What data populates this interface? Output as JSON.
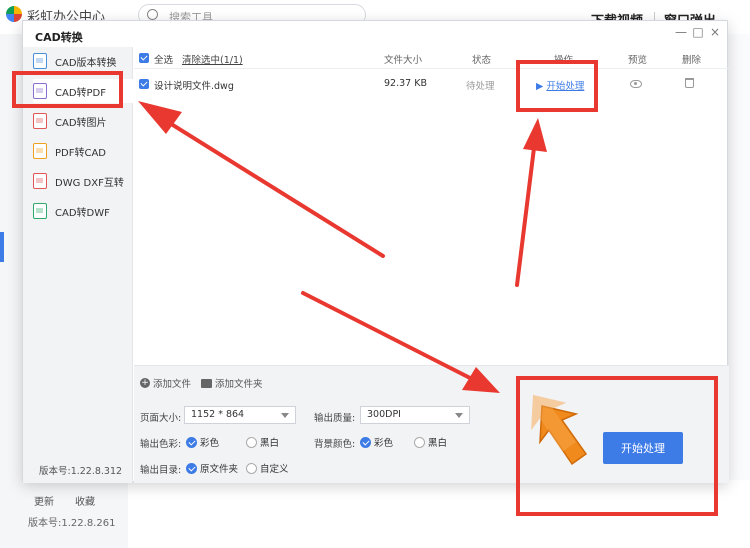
{
  "background": {
    "app_title": "彩虹办公中心",
    "search_placeholder": "搜索工具",
    "top_buttons": [
      "下载视频",
      "窗口弹出"
    ],
    "bottom_links": [
      "更新",
      "收藏"
    ],
    "version": "版本号:1.22.8.261"
  },
  "dialog": {
    "title": "CAD转换",
    "window_controls": [
      "—",
      "□",
      "×"
    ],
    "sidebar": [
      {
        "label": "CAD版本转换",
        "icon": "cad-version-icon",
        "color": "#4a90d9"
      },
      {
        "label": "CAD转PDF",
        "icon": "pdf-file-icon",
        "color": "#8a6fd1",
        "active": true
      },
      {
        "label": "CAD转图片",
        "icon": "image-file-icon",
        "color": "#e05555"
      },
      {
        "label": "PDF转CAD",
        "icon": "cad-file-icon",
        "color": "#f0a020"
      },
      {
        "label": "DWG DXF互转",
        "icon": "dwg-file-icon",
        "color": "#e05555"
      },
      {
        "label": "CAD转DWF",
        "icon": "dwf-file-icon",
        "color": "#2fa86b"
      }
    ],
    "version": "版本号:1.22.8.312",
    "table": {
      "select_all": "全选",
      "clear_selected": "清除选中(1/1)",
      "columns": [
        "文件大小",
        "状态",
        "操作",
        "预览",
        "删除"
      ],
      "rows": [
        {
          "name": "设计说明文件.dwg",
          "size": "92.37 KB",
          "status": "待处理",
          "action": "开始处理"
        }
      ]
    },
    "add_file": "添加文件",
    "add_folder": "添加文件夹",
    "options": {
      "page_size_label": "页面大小:",
      "page_size_value": "1152 * 864",
      "quality_label": "输出质量:",
      "quality_value": "300DPI",
      "color_label": "输出色彩:",
      "color_options": [
        {
          "label": "彩色",
          "checked": true
        },
        {
          "label": "黑白",
          "checked": false
        }
      ],
      "bg_label": "背景颜色:",
      "bg_options": [
        {
          "label": "彩色",
          "checked": true
        },
        {
          "label": "黑白",
          "checked": false
        }
      ],
      "dir_label": "输出目录:",
      "dir_options": [
        {
          "label": "原文件夹",
          "checked": true
        },
        {
          "label": "自定义",
          "checked": false
        }
      ]
    },
    "start_button": "开始处理"
  },
  "colors": {
    "accent": "#3d7be6",
    "annotation": "#e8382f",
    "orange_arrow": "#f08a1c"
  }
}
